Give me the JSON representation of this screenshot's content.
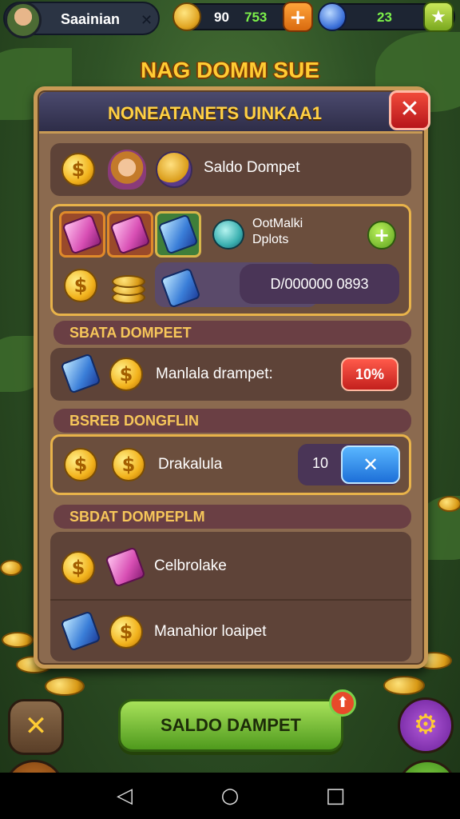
{
  "hud": {
    "player_name": "Saainian",
    "gold_value": "90",
    "gem_value": "753",
    "energy_value": "23"
  },
  "title": "NAG DOMM SUE",
  "panel": {
    "title": "NONEATANETS UINKAA1",
    "close_symbol": "✕",
    "saldo_label": "Saldo Dompet",
    "grid_label_line1": "OotMalki",
    "grid_label_line2": "Dplots",
    "add_symbol": "+",
    "grid_display_value": "D/000000 0893",
    "section1_label": "SBATA DOMPEET",
    "section1_row_label": "Manlala drampet:",
    "section1_badge": "10%",
    "section2_label": "BSREB DONGFLIN",
    "section2_row_label": "Drakalula",
    "stepper_value": "10",
    "stepper_button": "✕",
    "section3_label": "SBDAT DOMPEPLM",
    "section3_row1_label": "Celbrolake",
    "section3_row2_label": "Manahior loaipet"
  },
  "bottom": {
    "main_button": "SALDO DAMPET",
    "notif_symbol": "⬆"
  },
  "colors": {
    "accent_gold": "#ffcc33",
    "panel_bg": "#8b6a4f",
    "button_green": "#6fb52c",
    "close_red": "#d7261f",
    "badge_red": "#e03027",
    "stepper_blue": "#2f86ea"
  }
}
